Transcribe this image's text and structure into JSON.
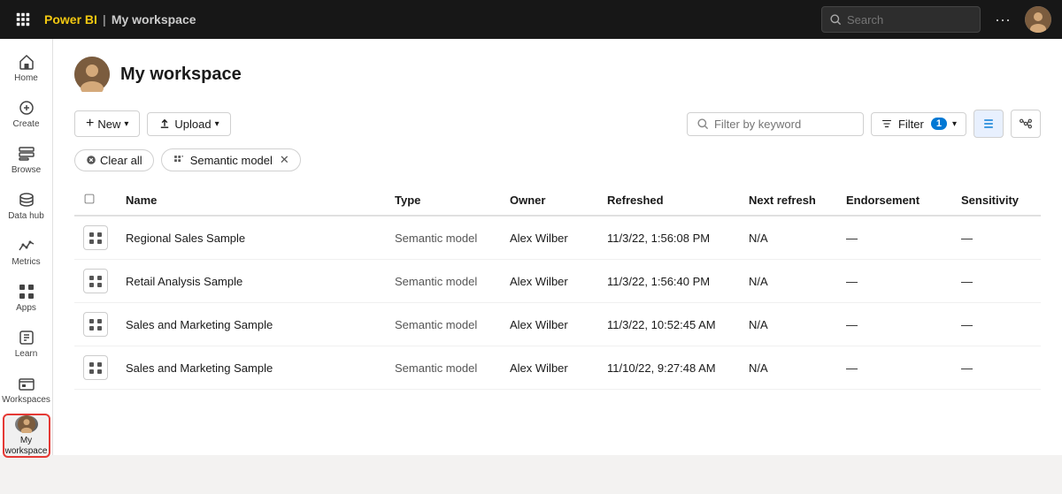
{
  "topbar": {
    "waffle_label": "⊞",
    "brand": "Power BI",
    "workspace_name": "My workspace",
    "search_placeholder": "Search",
    "more_label": "···"
  },
  "sidebar": {
    "items": [
      {
        "id": "home",
        "label": "Home",
        "icon": "home"
      },
      {
        "id": "create",
        "label": "Create",
        "icon": "create"
      },
      {
        "id": "browse",
        "label": "Browse",
        "icon": "browse"
      },
      {
        "id": "data-hub",
        "label": "Data hub",
        "icon": "data-hub"
      },
      {
        "id": "metrics",
        "label": "Metrics",
        "icon": "metrics"
      },
      {
        "id": "apps",
        "label": "Apps",
        "icon": "apps"
      },
      {
        "id": "learn",
        "label": "Learn",
        "icon": "learn"
      },
      {
        "id": "workspaces",
        "label": "Workspaces",
        "icon": "workspaces"
      },
      {
        "id": "my-workspace",
        "label": "My workspace",
        "icon": "avatar",
        "active": true
      }
    ]
  },
  "header": {
    "title": "My workspace"
  },
  "toolbar": {
    "new_label": "New",
    "upload_label": "Upload",
    "filter_placeholder": "Filter by keyword",
    "filter_label": "Filter",
    "filter_count": "(1)"
  },
  "filter_tags": {
    "clear_label": "Clear all",
    "tags": [
      {
        "label": "Semantic model",
        "removable": true
      }
    ]
  },
  "table": {
    "columns": [
      "",
      "Name",
      "Type",
      "Owner",
      "Refreshed",
      "Next refresh",
      "Endorsement",
      "Sensitivity"
    ],
    "rows": [
      {
        "name": "Regional Sales Sample",
        "type": "Semantic model",
        "owner": "Alex Wilber",
        "refreshed": "11/3/22, 1:56:08 PM",
        "next_refresh": "N/A",
        "endorsement": "—",
        "sensitivity": "—"
      },
      {
        "name": "Retail Analysis Sample",
        "type": "Semantic model",
        "owner": "Alex Wilber",
        "refreshed": "11/3/22, 1:56:40 PM",
        "next_refresh": "N/A",
        "endorsement": "—",
        "sensitivity": "—"
      },
      {
        "name": "Sales and Marketing Sample",
        "type": "Semantic model",
        "owner": "Alex Wilber",
        "refreshed": "11/3/22, 10:52:45 AM",
        "next_refresh": "N/A",
        "endorsement": "—",
        "sensitivity": "—"
      },
      {
        "name": "Sales and Marketing Sample",
        "type": "Semantic model",
        "owner": "Alex Wilber",
        "refreshed": "11/10/22, 9:27:48 AM",
        "next_refresh": "N/A",
        "endorsement": "—",
        "sensitivity": "—"
      }
    ]
  }
}
